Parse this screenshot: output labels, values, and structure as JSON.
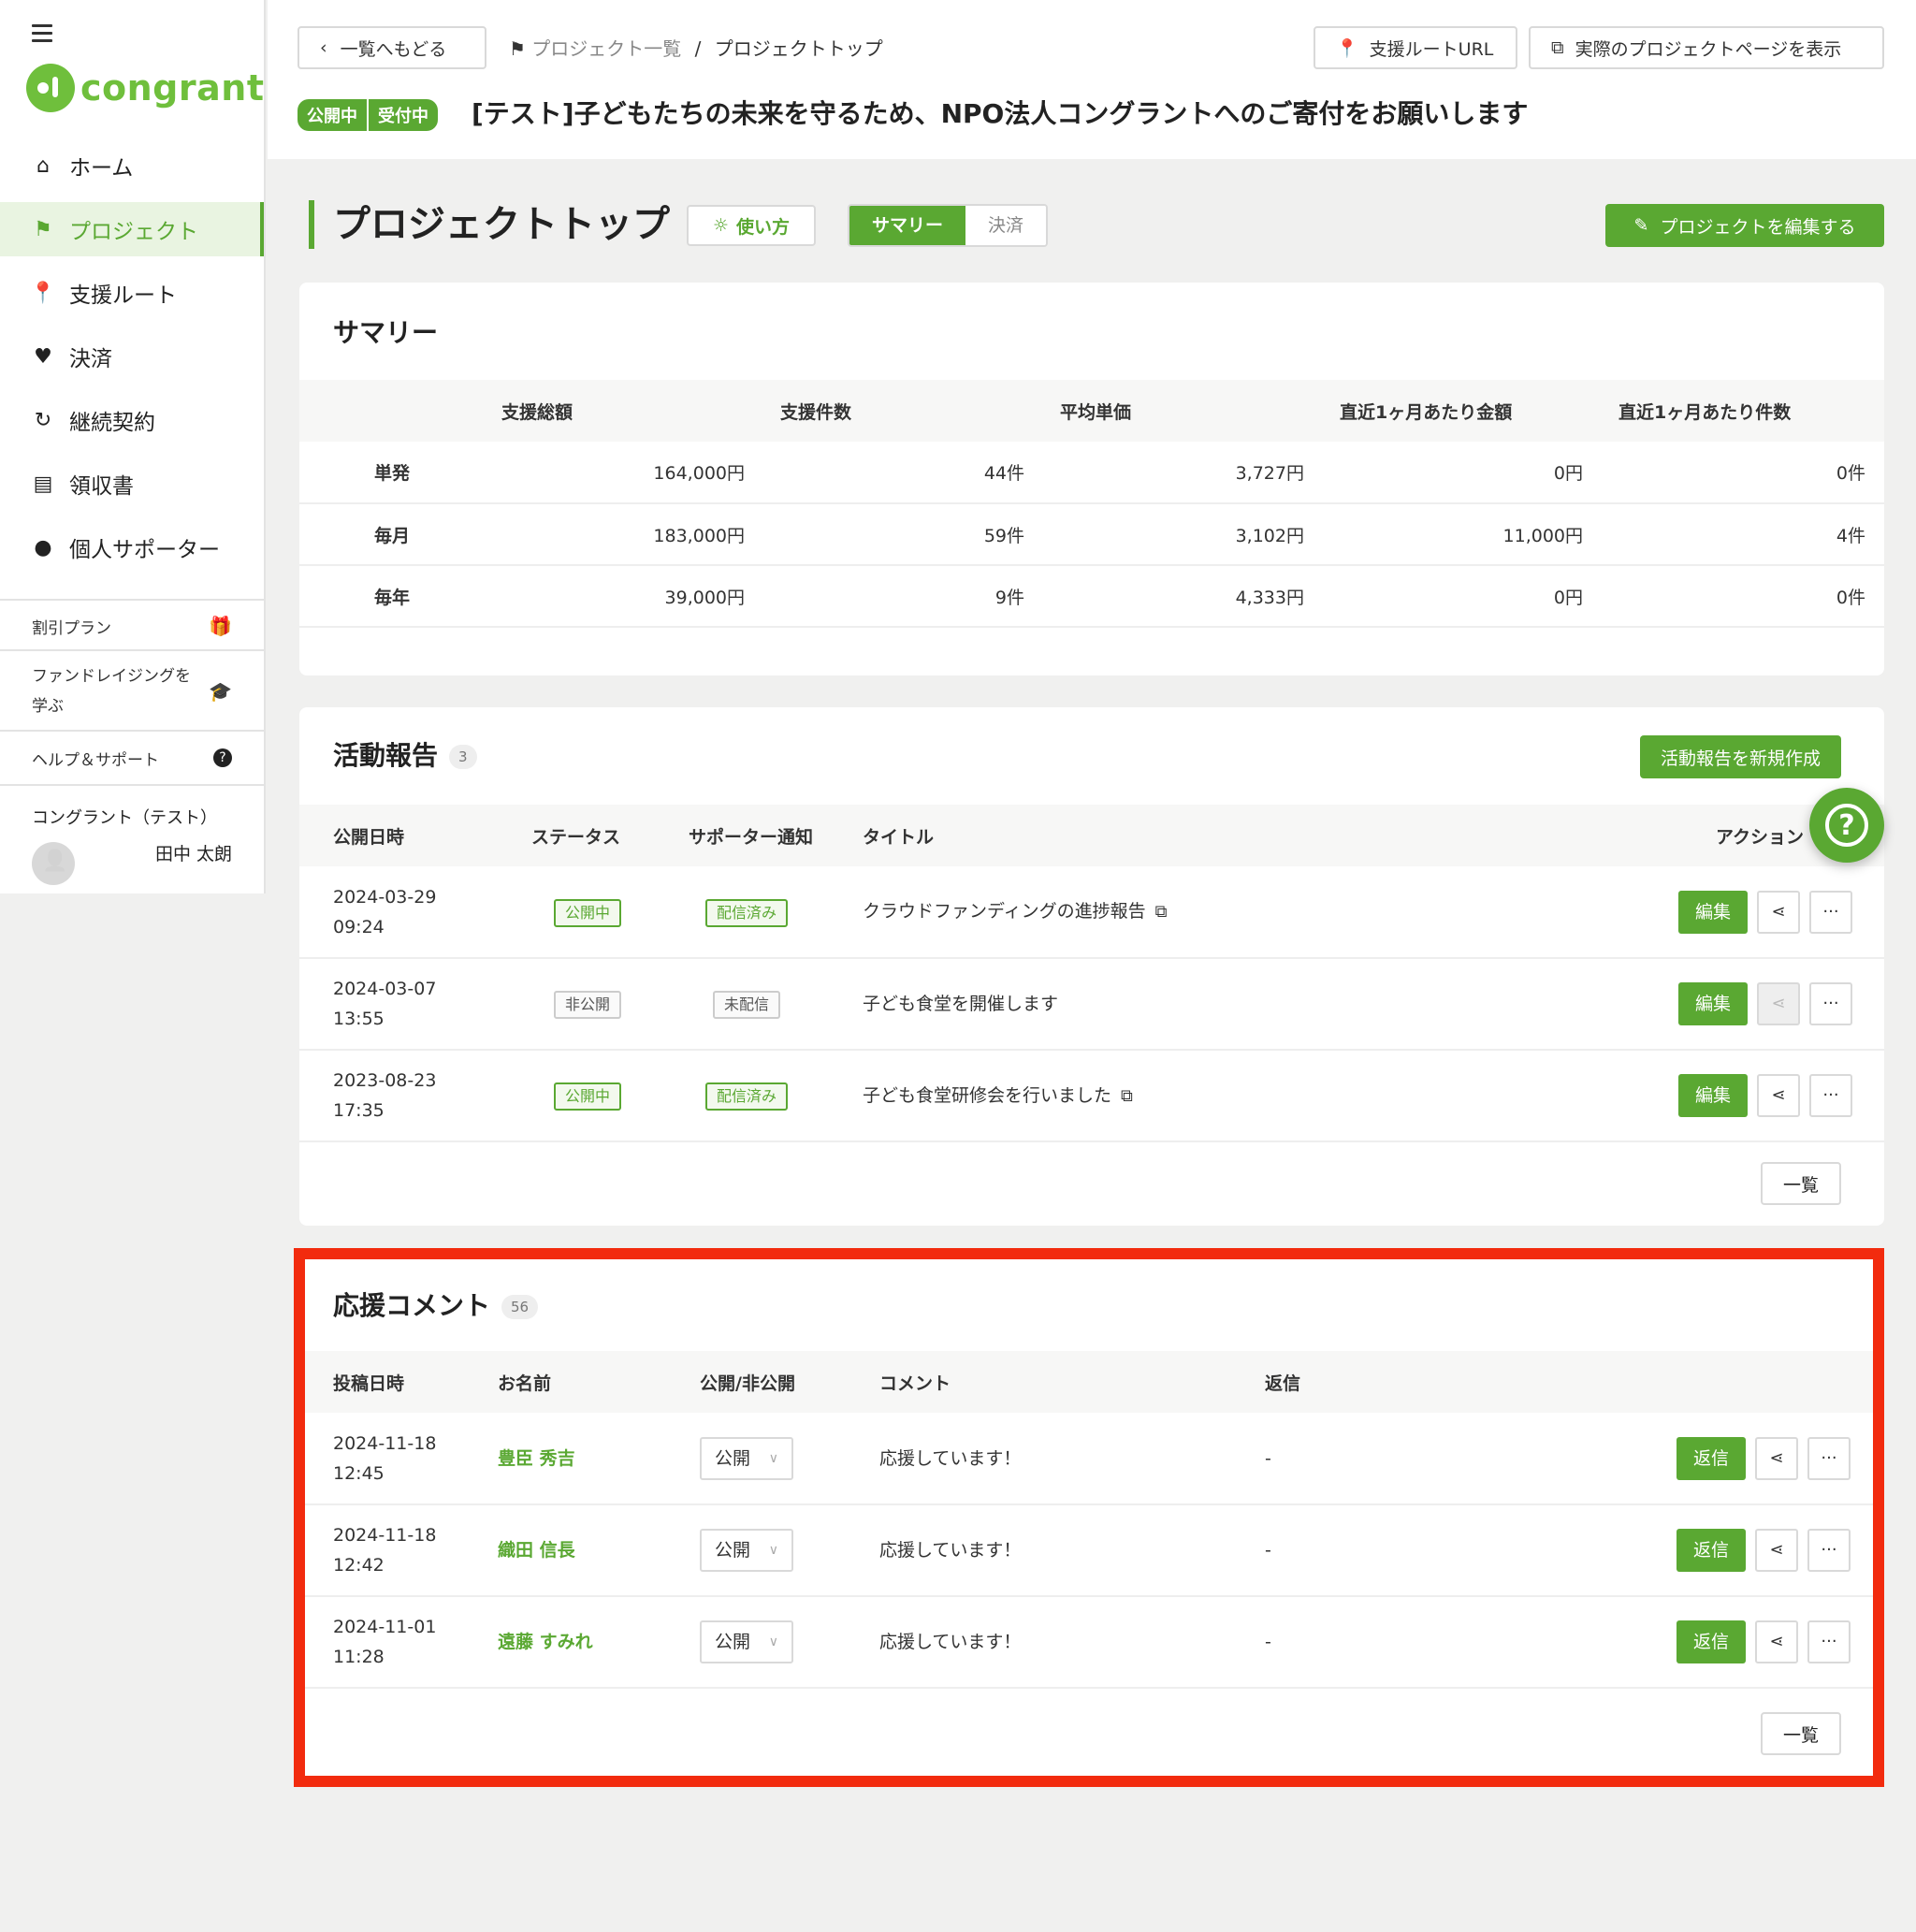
{
  "sidebar": {
    "logo": "congrant",
    "nav": [
      {
        "label": "ホーム",
        "icon": "home-icon"
      },
      {
        "label": "プロジェクト",
        "icon": "flag-icon"
      },
      {
        "label": "支援ルート",
        "icon": "pin-icon"
      },
      {
        "label": "決済",
        "icon": "heart-icon"
      },
      {
        "label": "継続契約",
        "icon": "refresh-icon"
      },
      {
        "label": "領収書",
        "icon": "receipt-icon"
      },
      {
        "label": "個人サポーター",
        "icon": "person-icon"
      }
    ],
    "sub": [
      {
        "label": "割引プラン"
      },
      {
        "label": "ファンドレイジングを学ぶ"
      },
      {
        "label": "ヘルプ＆サポート"
      }
    ],
    "org": "コングラント（テスト）",
    "user": "田中 太朗"
  },
  "header": {
    "back": "一覧へもどる",
    "breadcrumb_parent": "プロジェクト一覧",
    "breadcrumb_sep": "/",
    "breadcrumb_current": "プロジェクトトップ",
    "route_url_btn": "支援ルートURL",
    "view_page_btn": "実際のプロジェクトページを表示",
    "badge_published": "公開中",
    "badge_accepting": "受付中",
    "project_title": "[テスト]子どもたちの未来を守るため、NPO法人コングラントへのご寄付をお願いします"
  },
  "page": {
    "title": "プロジェクトトップ",
    "howto": "使い方",
    "tab_summary": "サマリー",
    "tab_payment": "決済",
    "edit_project": "プロジェクトを編集する"
  },
  "summary": {
    "title": "サマリー",
    "columns": [
      "支援総額",
      "支援件数",
      "平均単価",
      "直近1ヶ月あたり金額",
      "直近1ヶ月あたり件数"
    ],
    "rows": [
      {
        "label": "単発",
        "cells": [
          "164,000円",
          "44件",
          "3,727円",
          "0円",
          "0件"
        ]
      },
      {
        "label": "毎月",
        "cells": [
          "183,000円",
          "59件",
          "3,102円",
          "11,000円",
          "4件"
        ]
      },
      {
        "label": "毎年",
        "cells": [
          "39,000円",
          "9件",
          "4,333円",
          "0円",
          "0件"
        ]
      }
    ]
  },
  "activity": {
    "title": "活動報告",
    "count": "3",
    "new_btn": "活動報告を新規作成",
    "columns": [
      "公開日時",
      "ステータス",
      "サポーター通知",
      "タイトル",
      "アクション"
    ],
    "rows": [
      {
        "date": "2024-03-29",
        "time": "09:24",
        "status": "公開中",
        "notify": "配信済み",
        "title": "クラウドファンディングの進捗報告",
        "edit": "編集"
      },
      {
        "date": "2024-03-07",
        "time": "13:55",
        "status": "非公開",
        "notify": "未配信",
        "title": "子ども食堂を開催します",
        "edit": "編集"
      },
      {
        "date": "2023-08-23",
        "time": "17:35",
        "status": "公開中",
        "notify": "配信済み",
        "title": "子ども食堂研修会を行いました",
        "edit": "編集"
      }
    ],
    "list_btn": "一覧"
  },
  "comments": {
    "title": "応援コメント",
    "count": "56",
    "columns": [
      "投稿日時",
      "お名前",
      "公開/非公開",
      "コメント",
      "返信"
    ],
    "rows": [
      {
        "date": "2024-11-18",
        "time": "12:45",
        "name": "豊臣 秀吉",
        "visibility": "公開",
        "comment": "応援しています！",
        "reply": "-",
        "reply_btn": "返信"
      },
      {
        "date": "2024-11-18",
        "time": "12:42",
        "name": "織田 信長",
        "visibility": "公開",
        "comment": "応援しています！",
        "reply": "-",
        "reply_btn": "返信"
      },
      {
        "date": "2024-11-01",
        "time": "11:28",
        "name": "遠藤 すみれ",
        "visibility": "公開",
        "comment": "応援しています！",
        "reply": "-",
        "reply_btn": "返信"
      }
    ],
    "list_btn": "一覧"
  },
  "colors": {
    "accent": "#5aa832",
    "highlight": "#f22b0e"
  }
}
